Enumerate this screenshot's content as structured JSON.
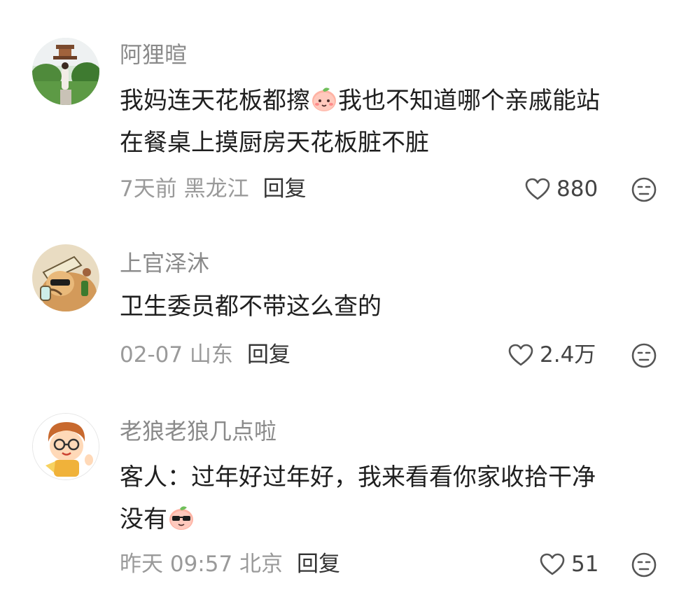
{
  "comments": [
    {
      "username": "阿狸暄",
      "line1": "我妈连天花板都擦",
      "emoji": "peach-blush-emoji",
      "line1b": "我也不知道哪个亲戚能站",
      "line2": "在餐桌上摸厨房天花板脏不脏",
      "meta": "7天前 黑龙江",
      "reply": "回复",
      "likes": "880"
    },
    {
      "username": "上官泽沐",
      "line1": "卫生委员都不带这么查的",
      "meta": "02-07 山东",
      "reply": "回复",
      "likes": "2.4万"
    },
    {
      "username": "老狼老狼几点啦",
      "line1": "客人：过年好过年好，我来看看你家收拾干净",
      "line2": "没有",
      "emoji": "peach-sunglasses-emoji",
      "meta": "昨天 09:57 北京",
      "reply": "回复",
      "likes": "51"
    }
  ],
  "icons": {
    "like": "heart-outline-icon",
    "dislike": "neutral-face-icon"
  },
  "colors": {
    "username": "#8a8a8a",
    "meta": "#9a9a9a",
    "text": "#1f1f1f",
    "background": "#ffffff"
  }
}
